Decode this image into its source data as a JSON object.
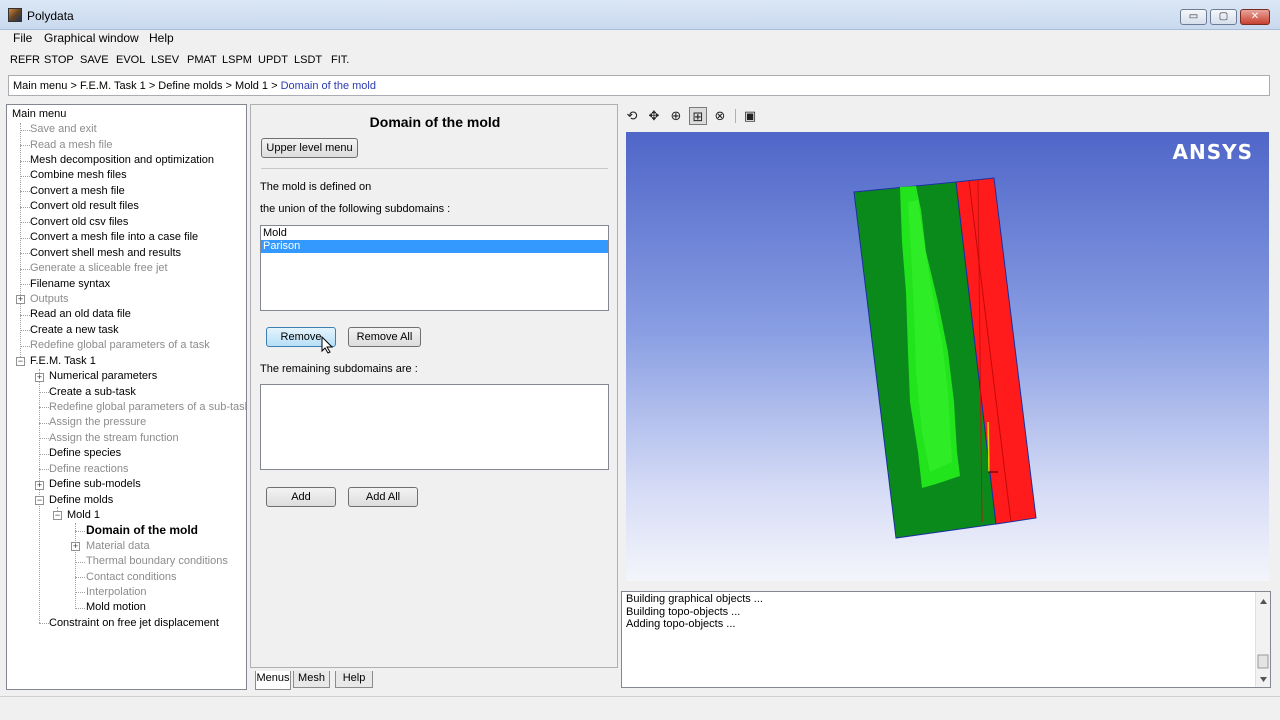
{
  "window": {
    "title": "Polydata",
    "min_glyph": "▭",
    "max_glyph": "▢",
    "close_glyph": "✕"
  },
  "menubar": [
    "File",
    "Graphical window",
    "Help"
  ],
  "toolbar": [
    "REFR",
    "STOP",
    "SAVE",
    "EVOL",
    "LSEV",
    "PMAT",
    "LSPM",
    "UPDT",
    "LSDT",
    "FIT."
  ],
  "breadcrumb": {
    "path": "Main menu > F.E.M. Task  1 > Define molds > Mold  1 > ",
    "current": "Domain of the mold"
  },
  "tree": {
    "root": "Main menu",
    "items": [
      {
        "label": "Save and exit",
        "state": "disabled"
      },
      {
        "label": "Read a mesh file",
        "state": "disabled"
      },
      {
        "label": "Mesh decomposition and optimization",
        "state": "enabled"
      },
      {
        "label": "Combine mesh files",
        "state": "enabled"
      },
      {
        "label": "Convert a mesh file",
        "state": "enabled"
      },
      {
        "label": "Convert old result files",
        "state": "enabled"
      },
      {
        "label": "Convert old csv files",
        "state": "enabled"
      },
      {
        "label": "Convert a mesh file into a case file",
        "state": "enabled"
      },
      {
        "label": "Convert shell mesh and results",
        "state": "enabled"
      },
      {
        "label": "Generate a sliceable free jet",
        "state": "disabled"
      },
      {
        "label": "Filename syntax",
        "state": "enabled"
      },
      {
        "label": "Outputs",
        "state": "disabled"
      },
      {
        "label": "Read an old data file",
        "state": "enabled"
      },
      {
        "label": "Create a new task",
        "state": "enabled"
      },
      {
        "label": "Redefine global parameters of a task",
        "state": "disabled"
      },
      {
        "label": "F.E.M. Task  1",
        "state": "enabled"
      },
      {
        "label": "Numerical parameters",
        "state": "enabled"
      },
      {
        "label": "Create a sub-task",
        "state": "enabled"
      },
      {
        "label": "Redefine global parameters of a sub-task",
        "state": "disabled"
      },
      {
        "label": "Assign the pressure",
        "state": "disabled"
      },
      {
        "label": "Assign the stream function",
        "state": "disabled"
      },
      {
        "label": "Define species",
        "state": "enabled"
      },
      {
        "label": "Define reactions",
        "state": "disabled"
      },
      {
        "label": "Define sub-models",
        "state": "enabled"
      },
      {
        "label": "Define molds",
        "state": "enabled"
      },
      {
        "label": "Mold  1",
        "state": "enabled"
      },
      {
        "label": "Domain of the mold",
        "state": "selected"
      },
      {
        "label": "Material data",
        "state": "disabled"
      },
      {
        "label": "Thermal boundary conditions",
        "state": "disabled"
      },
      {
        "label": "Contact conditions",
        "state": "disabled"
      },
      {
        "label": "Interpolation",
        "state": "disabled"
      },
      {
        "label": "Mold motion",
        "state": "enabled"
      },
      {
        "label": "Constraint on free jet displacement",
        "state": "enabled"
      }
    ],
    "expander_plus": "+",
    "expander_minus": "−"
  },
  "form": {
    "title": "Domain of the mold",
    "upper_level_button": "Upper level menu",
    "defined_on_label": "The mold is defined on",
    "union_label": "the union of the following subdomains :",
    "selected_subdomains": [
      "Mold",
      "Parison"
    ],
    "selected_index": 1,
    "remove_button": "Remove",
    "remove_all_button": "Remove All",
    "remaining_label": "The remaining subdomains are :",
    "remaining_subdomains": [],
    "add_button": "Add",
    "add_all_button": "Add All"
  },
  "tabs": [
    "Menus",
    "Mesh",
    "Help"
  ],
  "active_tab": "Menus",
  "graphics": {
    "tool_icons": [
      "rotate-icon",
      "pan-icon",
      "zoom-icon",
      "zoom-box-icon",
      "zoom-fit-icon",
      "snapshot-icon"
    ],
    "tool_glyphs": [
      "⟲",
      "✥",
      "⊕",
      "⊞",
      "⊗",
      "▣"
    ],
    "logo_text": "ANSYS",
    "colors": {
      "mold_green": "#0a8a1a",
      "parison_green": "#22e31c",
      "red_part": "#ff1b1b",
      "bg_top": "#4f66c8"
    }
  },
  "log": [
    "Building graphical objects ...",
    "Building topo-objects ...",
    "Adding topo-objects ..."
  ]
}
